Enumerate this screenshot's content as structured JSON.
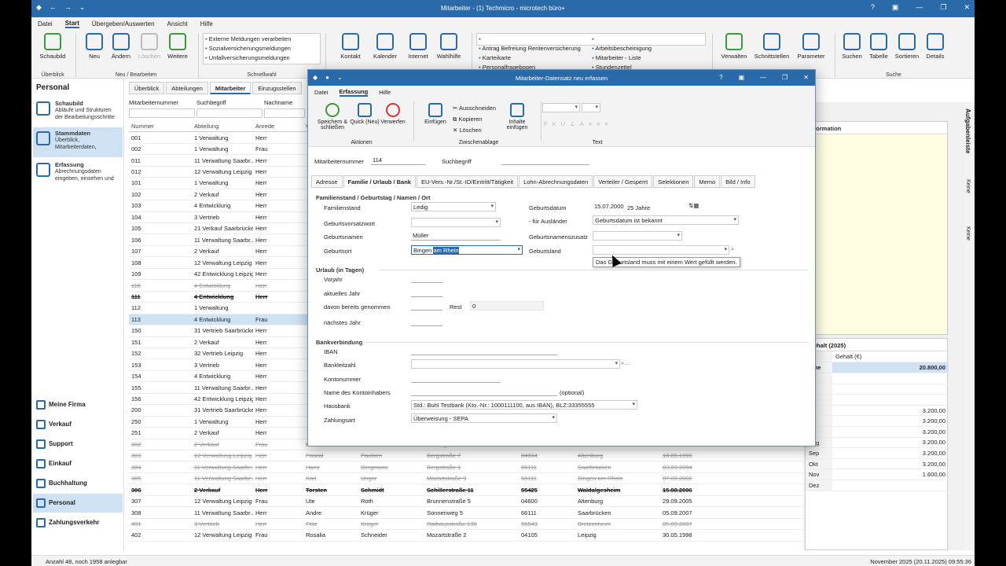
{
  "window": {
    "title": "Mitarbeiter - (1) Techmicro - microtech büro+"
  },
  "menu": [
    "Datei",
    "Start",
    "Übergeben/Auswerten",
    "Ansicht",
    "Hilfe"
  ],
  "ribbon": {
    "schaubild": "Schaubild",
    "neu": "Neu",
    "aendern": "Ändern",
    "loeschen": "Löschen",
    "weitere": "Weitere",
    "grp_ueberblick": "Überblick",
    "grp_neu": "Neu / Bearbeiten",
    "grp_schnellwahl": "Schnellwahl",
    "grp_suche": "Suche",
    "schnellwahl": [
      "Externe Meldungen verarbeiten",
      "Sozialversicherungsmeldungen",
      "Unfallversicherungsmeldungen"
    ],
    "kontakt": "Kontakt",
    "kalender": "Kalender",
    "internet": "Internet",
    "wahlhilfe": "Wahlhilfe",
    "list1": [
      "Antrag Befreiung Rentenversicherung",
      "Karteikarte",
      "Personalfragebogen"
    ],
    "list2": [
      "Arbeitsbescheinigung",
      "Mitarbeiter - Liste",
      "Stundenzettel"
    ],
    "verwalten": "Verwalten",
    "schnittstellen": "Schnittstellen",
    "parameter": "Parameter",
    "suchen": "Suchen",
    "tabelle": "Tabelle",
    "sortieren": "Sortieren",
    "details": "Details"
  },
  "left": {
    "title": "Personal",
    "nav": [
      {
        "title": "Schaubild",
        "desc": "Abläufe und Strukturen der Bearbeitungsschritte"
      },
      {
        "title": "Stammdaten",
        "desc": "Überblick, Mitarbeiterdaten,"
      },
      {
        "title": "Erfassung",
        "desc": "Abrechnungsdaten eingeben, einsehen und"
      }
    ],
    "bottom": [
      "Meine Firma",
      "Verkauf",
      "Support",
      "Einkauf",
      "Buchhaltung",
      "Personal",
      "Zahlungsverkehr"
    ]
  },
  "tabs": [
    "Überblick",
    "Abteilungen",
    "Mitarbeiter",
    "Einzugsstellen"
  ],
  "filter": {
    "nr": "Mitarbeiternummer",
    "such": "Suchbegriff",
    "name": "Nachname"
  },
  "grid": {
    "headers": [
      "Nummer",
      "Abteilung",
      "Anrede",
      "V"
    ],
    "rows": [
      [
        "001",
        "1 Verwaltung",
        "Herr",
        "",
        ""
      ],
      [
        "002",
        "1 Verwaltung",
        "Frau",
        "",
        ""
      ],
      [
        "011",
        "11 Verwaltung Saarbr...",
        "Herr",
        "",
        ""
      ],
      [
        "012",
        "12 Verwaltung Leipzig",
        "Herr",
        "",
        ""
      ],
      [
        "101",
        "1 Verwaltung",
        "Herr",
        "",
        ""
      ],
      [
        "102",
        "2 Verkauf",
        "Herr",
        "",
        ""
      ],
      [
        "103",
        "4 Entwicklung",
        "Herr",
        "",
        ""
      ],
      [
        "104",
        "3 Vertrieb",
        "Herr",
        "",
        ""
      ],
      [
        "105",
        "21 Verkauf Saarbrücken",
        "Herr",
        "",
        ""
      ],
      [
        "106",
        "11 Verwaltung Saarbr...",
        "Herr",
        "",
        ""
      ],
      [
        "107",
        "2 Verkauf",
        "Herr",
        "",
        ""
      ],
      [
        "108",
        "12 Verwaltung Leipzig",
        "Herr",
        "",
        ""
      ],
      [
        "109",
        "42 Entwicklung Leipzig",
        "Herr",
        "",
        ""
      ],
      [
        "110",
        "4 Entwicklung",
        "Herr",
        "",
        "strike"
      ],
      [
        "111",
        "4 Entwicklung",
        "Herr",
        "",
        "strike bold"
      ],
      [
        "112",
        "1 Verwaltung",
        "",
        "",
        ""
      ],
      [
        "113",
        "4 Entwicklung",
        "Frau",
        "",
        "sel"
      ],
      [
        "150",
        "31 Vertrieb Saarbrücken",
        "Herr",
        "",
        ""
      ],
      [
        "151",
        "2 Verkauf",
        "Herr",
        "",
        ""
      ],
      [
        "152",
        "32 Vertrieb Leipzig",
        "Herr",
        "",
        ""
      ],
      [
        "153",
        "3 Vertrieb",
        "Herr",
        "",
        ""
      ],
      [
        "154",
        "4 Entwicklung",
        "Herr",
        "",
        ""
      ],
      [
        "155",
        "11 Verwaltung Saarbr...",
        "Herr",
        "",
        ""
      ],
      [
        "156",
        "42 Entwicklung Leipzig",
        "Herr",
        "",
        ""
      ],
      [
        "200",
        "31 Vertrieb Saarbrücken",
        "Herr",
        "",
        ""
      ],
      [
        "250",
        "1 Verwaltung",
        "Herr",
        "",
        ""
      ],
      [
        "251",
        "2 Verkauf",
        "Herr",
        "",
        ""
      ]
    ],
    "bottom_rows": [
      [
        "302",
        "2 Verkauf",
        "Frau",
        "Rubina",
        "Dreher",
        "Lessingstraße 1",
        "55543",
        "Bad Kreuznach",
        "15.05.2006",
        "strike"
      ],
      [
        "303",
        "12 Verwaltung Leipzig",
        "Herr",
        "Pascal",
        "Paulsen",
        "Bergstraße 7",
        "84034",
        "Altenburg",
        "18.05.1999",
        "strike"
      ],
      [
        "304",
        "11 Verwaltung Saarbr...",
        "Herr",
        "Hans",
        "Bergmann",
        "Bergstraße 1",
        "66111",
        "Saarbrücken",
        "03.03.2004",
        "strike"
      ],
      [
        "305",
        "11 Verwaltung Saarbr...",
        "Herr",
        "Karl",
        "Unger",
        "Mozartstraße 9",
        "66111",
        "Bingen am Rhein",
        "07.08.2002",
        "strike"
      ],
      [
        "306",
        "2 Verkauf",
        "Herr",
        "Torsten",
        "Schmidt",
        "Schillerstraße 11",
        "55425",
        "Waldalgesheim",
        "15.08.2006",
        "strike bold"
      ],
      [
        "307",
        "12 Verwaltung Leipzig",
        "Frau",
        "Ute",
        "Roth",
        "Brunnenstraße 5",
        "04600",
        "Altenburg",
        "29.09.2005",
        ""
      ],
      [
        "308",
        "11 Verwaltung Saarbr...",
        "Herr",
        "Andre",
        "Krüger",
        "Sonnenweg 5",
        "66111",
        "Saarbrücken",
        "05.09.2007",
        ""
      ],
      [
        "401",
        "3 Vertrieb",
        "Herr",
        "Fritz",
        "Krüger",
        "Rathausstraße 130",
        "55543",
        "Bretzenheim",
        "05.09.2007",
        "strike"
      ],
      [
        "402",
        "12 Verwaltung Leipzig",
        "Frau",
        "Rosalia",
        "Schneider",
        "Mozartstraße 2",
        "04105",
        "Leipzig",
        "30.05.1998",
        ""
      ]
    ]
  },
  "info": {
    "title": "Information"
  },
  "salary": {
    "title": "Gehalt (2025)",
    "col": "Gehalt (€)",
    "total_label": "nme",
    "total": "20.800,00",
    "rows": [
      [
        "",
        ""
      ],
      [
        "",
        ""
      ],
      [
        "",
        ""
      ],
      [
        "",
        "3.200,00"
      ],
      [
        "",
        "3.200,00"
      ],
      [
        "",
        "3.200,00"
      ],
      [
        "Aug",
        "3.200,00"
      ],
      [
        "Sep",
        "3.200,00"
      ],
      [
        "Okt",
        "3.200,00"
      ],
      [
        "Nov",
        "1.600,00"
      ],
      [
        "Dez",
        ""
      ]
    ]
  },
  "vbar": {
    "title": "Aufgabenleiste",
    "k1": "Keine",
    "k2": "Keine"
  },
  "status": {
    "left": "Anzahl 48, noch 1958 anlegbar",
    "right": "November 2025   (20.11.2025)   09:55:36"
  },
  "dialog": {
    "title": "Mitarbeiter-Datensatz neu erfassen",
    "menu": [
      "Datei",
      "Erfassung",
      "Hilfe"
    ],
    "btn": {
      "save": "Speichern & schließen",
      "quick": "Quick (Neu)",
      "discard": "Verwerfen",
      "paste": "Einfügen",
      "cut": "Ausschneiden",
      "copy": "Kopieren",
      "del": "Löschen",
      "insert": "Inhalte einfügen"
    },
    "grp": {
      "actions": "Aktionen",
      "clip": "Zwischenablage",
      "text": "Text"
    },
    "nr_label": "Mitarbeiternummer",
    "nr": "114",
    "such_label": "Suchbegriff",
    "tabs": [
      "Adresse",
      "Familie / Urlaub / Bank",
      "EU-Vers.-Nr./St.-ID/Eintritt/Tätigkeit",
      "Lohn-Abrechnungsdaten",
      "Verteiler / Gesperrt",
      "Selektionen",
      "Memo",
      "Bild / Info"
    ],
    "sec1": "Familienstand / Geburtstag / Namen / Ort",
    "familienstand_l": "Familienstand",
    "familienstand": "Ledig",
    "vorsatz_l": "Geburtsvorsatzwort",
    "gname_l": "Geburtsnamen",
    "gname": "Müller",
    "gort_l": "Geburtsort",
    "gort_a": "Bingen",
    "gort_b": "am Rhein",
    "gdat_l": "Geburtsdatum",
    "gdat": "15.07.2000",
    "alter": "25 Jahre",
    "ausl_l": "- für Ausländer",
    "ausl": "Geburtsdatum ist bekannt",
    "zusatz_l": "Geburtsnamenszusatz",
    "gland_l": "Geburtsland",
    "tooltip": "Das Geburtsland muss mit einem Wert gefüllt werden.",
    "sec2": "Urlaub (in Tagen)",
    "vorjahr": "Vorjahr",
    "akt": "aktuelles Jahr",
    "genommen": "davon bereits genommen",
    "rest_l": "Rest",
    "rest": "0",
    "naechstes": "nächstes Jahr",
    "sec3": "Bankverbindung",
    "iban": "IBAN",
    "blz": "Bankleitzahl",
    "konto": "Kontonummer",
    "inhaber": "Name des Kontoinhabers",
    "optional": "(optional)",
    "hausbank_l": "Hausbank",
    "hausbank": "Std.: Buhl Testbank (Kto.-Nr.: 1000111100, aus IBAN), BLZ:33355555",
    "zahl_l": "Zahlungsart",
    "zahl": "Überweisung - SEPA"
  }
}
